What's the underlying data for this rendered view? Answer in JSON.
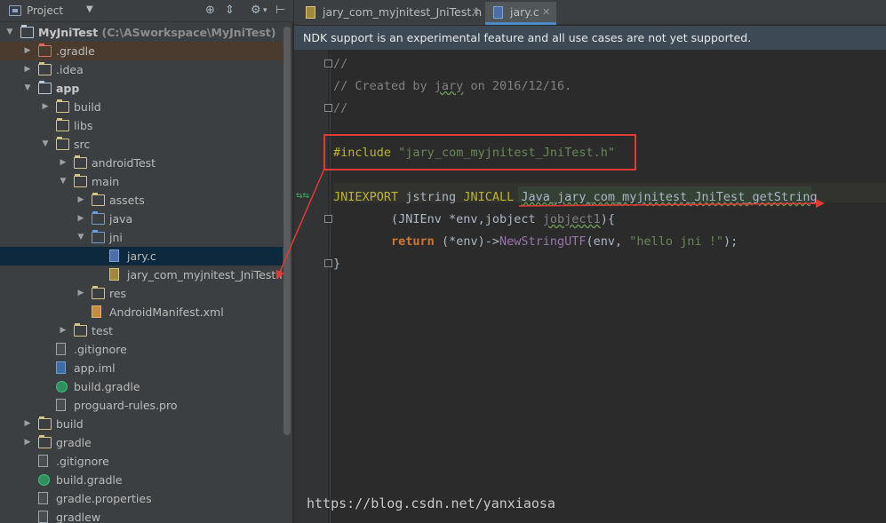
{
  "project_panel": {
    "label": "Project",
    "tree": [
      {
        "depth": 0,
        "label": "MyJniTest",
        "path": "(C:\\ASworkspace\\MyJniTest)",
        "type": "module",
        "arrow": "open",
        "bold": true
      },
      {
        "depth": 1,
        "label": ".gradle",
        "type": "folder-red",
        "arrow": "closed",
        "highlight": true
      },
      {
        "depth": 1,
        "label": ".idea",
        "type": "folder",
        "arrow": "closed"
      },
      {
        "depth": 1,
        "label": "app",
        "type": "module",
        "arrow": "open",
        "bold": true
      },
      {
        "depth": 2,
        "label": "build",
        "type": "folder",
        "arrow": "closed"
      },
      {
        "depth": 2,
        "label": "libs",
        "type": "folder",
        "arrow": "none"
      },
      {
        "depth": 2,
        "label": "src",
        "type": "folder",
        "arrow": "open"
      },
      {
        "depth": 3,
        "label": "androidTest",
        "type": "folder",
        "arrow": "closed"
      },
      {
        "depth": 3,
        "label": "main",
        "type": "folder",
        "arrow": "open"
      },
      {
        "depth": 4,
        "label": "assets",
        "type": "folder",
        "arrow": "closed"
      },
      {
        "depth": 4,
        "label": "java",
        "type": "folder-blue",
        "arrow": "closed"
      },
      {
        "depth": 4,
        "label": "jni",
        "type": "folder-blue",
        "arrow": "open"
      },
      {
        "depth": 5,
        "label": "jary.c",
        "type": "file-c",
        "arrow": "none",
        "selected": true
      },
      {
        "depth": 5,
        "label": "jary_com_myjnitest_JniTest.h",
        "type": "file-h",
        "arrow": "none"
      },
      {
        "depth": 4,
        "label": "res",
        "type": "folder",
        "arrow": "closed"
      },
      {
        "depth": 4,
        "label": "AndroidManifest.xml",
        "type": "file-xml",
        "arrow": "none"
      },
      {
        "depth": 3,
        "label": "test",
        "type": "folder",
        "arrow": "closed"
      },
      {
        "depth": 2,
        "label": ".gitignore",
        "type": "file",
        "arrow": "none"
      },
      {
        "depth": 2,
        "label": "app.iml",
        "type": "file-iml",
        "arrow": "none"
      },
      {
        "depth": 2,
        "label": "build.gradle",
        "type": "file-gradle",
        "arrow": "none"
      },
      {
        "depth": 2,
        "label": "proguard-rules.pro",
        "type": "file",
        "arrow": "none"
      },
      {
        "depth": 1,
        "label": "build",
        "type": "folder",
        "arrow": "closed"
      },
      {
        "depth": 1,
        "label": "gradle",
        "type": "folder",
        "arrow": "closed"
      },
      {
        "depth": 1,
        "label": ".gitignore",
        "type": "file",
        "arrow": "none"
      },
      {
        "depth": 1,
        "label": "build.gradle",
        "type": "file-gradle",
        "arrow": "none"
      },
      {
        "depth": 1,
        "label": "gradle.properties",
        "type": "file",
        "arrow": "none"
      },
      {
        "depth": 1,
        "label": "gradlew",
        "type": "file",
        "arrow": "none"
      }
    ]
  },
  "editor": {
    "tabs": [
      {
        "label": "jary_com_myjnitest_JniTest.h",
        "icon": "h-file-icon",
        "active": false
      },
      {
        "label": "jary.c",
        "icon": "c-file-icon",
        "active": true
      }
    ],
    "banner": "NDK support is an experimental feature and all use cases are not yet supported.",
    "code": {
      "comment1": "//",
      "comment2_prefix": "// Created by ",
      "comment2_user": "jary",
      "comment2_suffix": " on 2016/12/16.",
      "comment3": "//",
      "include_kw": "#include",
      "include_str": "\"jary_com_myjnitest_JniTest.h\"",
      "l5_export": "JNIEXPORT",
      "l5_type": " jstring ",
      "l5_call": "JNICALL",
      "l5_func": "Java_jary_com_myjnitest_JniTest_getString",
      "l6_open": "(JNIEnv *env,jobject ",
      "l6_param": "jobject1",
      "l6_close": "){",
      "l7_kw": "return",
      "l7_mid": " (*env)->",
      "l7_fn": "NewStringUTF",
      "l7_args": "(env, ",
      "l7_str": "\"hello jni !\"",
      "l7_end": ");",
      "l8": "}"
    }
  },
  "watermark": "https://blog.csdn.net/yanxiaosa",
  "colors": {
    "annotation_red": "#e53935",
    "selection": "#0d293e",
    "banner": "#3d4a55"
  }
}
